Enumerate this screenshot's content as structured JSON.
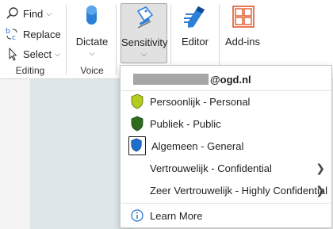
{
  "editing": {
    "find_label": "Find",
    "replace_label": "Replace",
    "select_label": "Select",
    "group_label": "Editing"
  },
  "voice": {
    "dictate_label": "Dictate",
    "group_label": "Voice"
  },
  "sensitivity": {
    "button_label": "Sensitivity"
  },
  "editor": {
    "label": "Editor"
  },
  "addins": {
    "label": "Add-ins"
  },
  "menu": {
    "account_domain": "@ogd.nl",
    "items": [
      {
        "label": "Persoonlijk - Personal",
        "icon": "shield-lime-icon",
        "color": "#b4cc1c"
      },
      {
        "label": "Publiek - Public",
        "icon": "shield-green-icon",
        "color": "#2e6b1f"
      },
      {
        "label": "Algemeen - General",
        "icon": "shield-blue-icon",
        "color": "#1f6fcc",
        "selected": true
      },
      {
        "label": "Vertrouwelijk - Confidential",
        "submenu": true
      },
      {
        "label": "Zeer Vertrouwelijk - Highly Confidential",
        "submenu": true
      }
    ],
    "learn_more": "Learn More"
  },
  "colors": {
    "accent_blue": "#1f6fcc",
    "addins_orange": "#e0582a"
  }
}
